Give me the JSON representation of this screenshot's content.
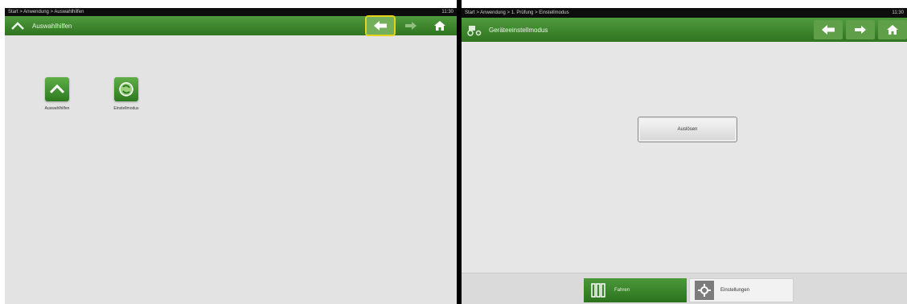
{
  "left": {
    "status_breadcrumb": "Start > Anwendung > Auswahlhilfen",
    "status_time": "11:30",
    "title": "Auswahlhilfen",
    "launchers": [
      {
        "label": "Auswahlhilfen",
        "icon": "chevron-up-icon"
      },
      {
        "label": "Einstellmodus",
        "icon": "recycle-icon"
      }
    ]
  },
  "right": {
    "status_breadcrumb": "Start > Anwendung > 1. Prüfung > Einstellmodus",
    "status_time": "11:30",
    "title": "Geräteeinstellmodus",
    "action_button": "Auslösen",
    "tabs": [
      {
        "label": "Fahren",
        "active": true
      },
      {
        "label": "Einstellungen",
        "active": false
      }
    ]
  },
  "colors": {
    "title_green": "#3b8429",
    "tile_green": "#4a9a37",
    "highlight": "#e6d21a"
  }
}
